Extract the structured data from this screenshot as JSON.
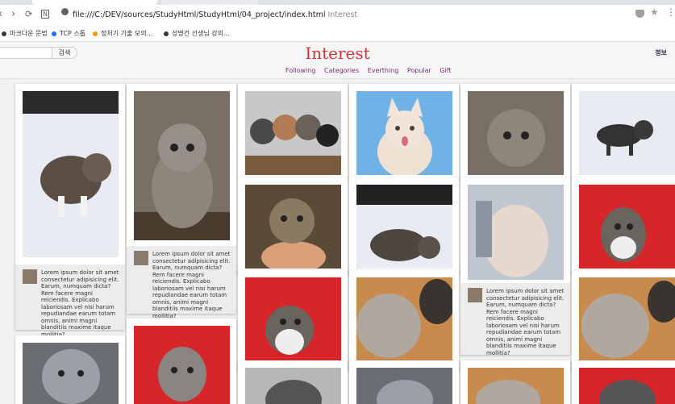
{
  "browser": {
    "nav": {
      "back": "‹",
      "forward": "›",
      "reload": "⟳",
      "home": "N"
    },
    "url": "file:///C:/DEV/sources/StudyHtml/StudyHtml/04_project/index.html",
    "url_suffix": "Interest",
    "bookmarks": [
      {
        "label": "마크다운 문법",
        "color": "#333333"
      },
      {
        "label": "TCP 스톱",
        "color": "#1a73e8"
      },
      {
        "label": "정처기 기출 모의...",
        "color": "#f29900"
      },
      {
        "label": "성명건 선생님 강의...",
        "color": "#333333"
      }
    ]
  },
  "header": {
    "search_placeholder": "",
    "search_button": "검색",
    "logo": "Interest",
    "user_menu": "정보",
    "nav": [
      "Following",
      "Categories",
      "Everthing",
      "Popular",
      "Gift"
    ]
  },
  "card_text": "Lorem ipsum dolor sit amet consectetur adipisicing elit. Earum, numquam dicta? Rem facere magni reiciendis. Explicabo laboriosam vel nisi harum repudiandae earum totam omnis, animi magni blanditiis maxime itaque mollitia?",
  "cards": [
    {
      "photo": "kitten-in-snow",
      "has_info": true
    },
    {
      "photo": "tabby-kitten-sitting",
      "has_info": true
    },
    {
      "photo": "grey-kitten",
      "has_info": false
    },
    {
      "photo": "kitten-on-red",
      "has_info": false
    },
    {
      "photo": "kittens-group",
      "has_info": false
    },
    {
      "photo": "kitten-on-hand",
      "has_info": false
    },
    {
      "photo": "kitten-on-red",
      "has_info": false
    },
    {
      "photo": "white-kitten-sky",
      "has_info": false
    },
    {
      "photo": "kitten-in-snow",
      "has_info": false
    },
    {
      "photo": "kitten-paws-closeup",
      "has_info": false
    },
    {
      "photo": "tabby-kitten-sitting",
      "has_info": false
    },
    {
      "photo": "blurry-kitten",
      "has_info": true
    },
    {
      "photo": "kitten-paws-closeup",
      "has_info": false
    },
    {
      "photo": "kitten-in-snow",
      "has_info": false
    },
    {
      "photo": "kitten-on-red",
      "has_info": false
    },
    {
      "photo": "kitten-paws-closeup",
      "has_info": false
    }
  ],
  "colors": {
    "logo": "#d8303a",
    "nav": "#7a2b7a",
    "snow": "#e8ecf2",
    "red": "#d7262a"
  }
}
